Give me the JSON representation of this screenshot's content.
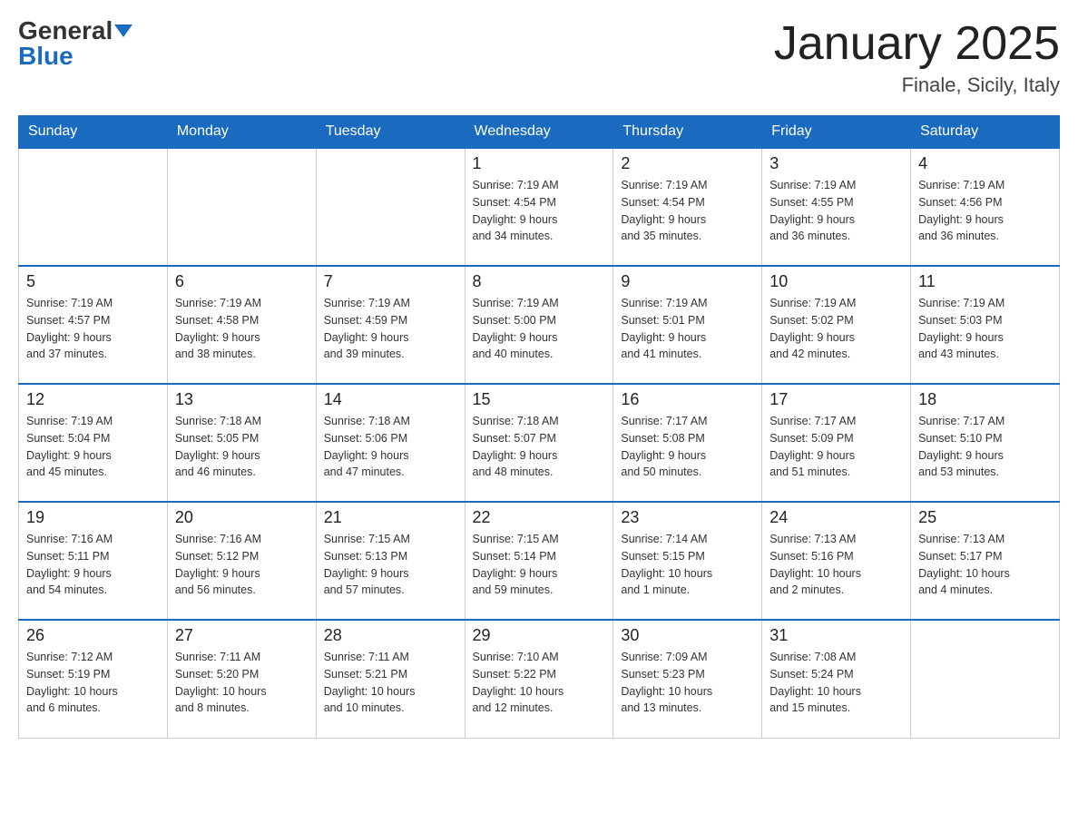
{
  "logo": {
    "general": "General",
    "blue": "Blue"
  },
  "header": {
    "month": "January 2025",
    "location": "Finale, Sicily, Italy"
  },
  "days_of_week": [
    "Sunday",
    "Monday",
    "Tuesday",
    "Wednesday",
    "Thursday",
    "Friday",
    "Saturday"
  ],
  "weeks": [
    [
      {
        "day": "",
        "info": ""
      },
      {
        "day": "",
        "info": ""
      },
      {
        "day": "",
        "info": ""
      },
      {
        "day": "1",
        "info": "Sunrise: 7:19 AM\nSunset: 4:54 PM\nDaylight: 9 hours\nand 34 minutes."
      },
      {
        "day": "2",
        "info": "Sunrise: 7:19 AM\nSunset: 4:54 PM\nDaylight: 9 hours\nand 35 minutes."
      },
      {
        "day": "3",
        "info": "Sunrise: 7:19 AM\nSunset: 4:55 PM\nDaylight: 9 hours\nand 36 minutes."
      },
      {
        "day": "4",
        "info": "Sunrise: 7:19 AM\nSunset: 4:56 PM\nDaylight: 9 hours\nand 36 minutes."
      }
    ],
    [
      {
        "day": "5",
        "info": "Sunrise: 7:19 AM\nSunset: 4:57 PM\nDaylight: 9 hours\nand 37 minutes."
      },
      {
        "day": "6",
        "info": "Sunrise: 7:19 AM\nSunset: 4:58 PM\nDaylight: 9 hours\nand 38 minutes."
      },
      {
        "day": "7",
        "info": "Sunrise: 7:19 AM\nSunset: 4:59 PM\nDaylight: 9 hours\nand 39 minutes."
      },
      {
        "day": "8",
        "info": "Sunrise: 7:19 AM\nSunset: 5:00 PM\nDaylight: 9 hours\nand 40 minutes."
      },
      {
        "day": "9",
        "info": "Sunrise: 7:19 AM\nSunset: 5:01 PM\nDaylight: 9 hours\nand 41 minutes."
      },
      {
        "day": "10",
        "info": "Sunrise: 7:19 AM\nSunset: 5:02 PM\nDaylight: 9 hours\nand 42 minutes."
      },
      {
        "day": "11",
        "info": "Sunrise: 7:19 AM\nSunset: 5:03 PM\nDaylight: 9 hours\nand 43 minutes."
      }
    ],
    [
      {
        "day": "12",
        "info": "Sunrise: 7:19 AM\nSunset: 5:04 PM\nDaylight: 9 hours\nand 45 minutes."
      },
      {
        "day": "13",
        "info": "Sunrise: 7:18 AM\nSunset: 5:05 PM\nDaylight: 9 hours\nand 46 minutes."
      },
      {
        "day": "14",
        "info": "Sunrise: 7:18 AM\nSunset: 5:06 PM\nDaylight: 9 hours\nand 47 minutes."
      },
      {
        "day": "15",
        "info": "Sunrise: 7:18 AM\nSunset: 5:07 PM\nDaylight: 9 hours\nand 48 minutes."
      },
      {
        "day": "16",
        "info": "Sunrise: 7:17 AM\nSunset: 5:08 PM\nDaylight: 9 hours\nand 50 minutes."
      },
      {
        "day": "17",
        "info": "Sunrise: 7:17 AM\nSunset: 5:09 PM\nDaylight: 9 hours\nand 51 minutes."
      },
      {
        "day": "18",
        "info": "Sunrise: 7:17 AM\nSunset: 5:10 PM\nDaylight: 9 hours\nand 53 minutes."
      }
    ],
    [
      {
        "day": "19",
        "info": "Sunrise: 7:16 AM\nSunset: 5:11 PM\nDaylight: 9 hours\nand 54 minutes."
      },
      {
        "day": "20",
        "info": "Sunrise: 7:16 AM\nSunset: 5:12 PM\nDaylight: 9 hours\nand 56 minutes."
      },
      {
        "day": "21",
        "info": "Sunrise: 7:15 AM\nSunset: 5:13 PM\nDaylight: 9 hours\nand 57 minutes."
      },
      {
        "day": "22",
        "info": "Sunrise: 7:15 AM\nSunset: 5:14 PM\nDaylight: 9 hours\nand 59 minutes."
      },
      {
        "day": "23",
        "info": "Sunrise: 7:14 AM\nSunset: 5:15 PM\nDaylight: 10 hours\nand 1 minute."
      },
      {
        "day": "24",
        "info": "Sunrise: 7:13 AM\nSunset: 5:16 PM\nDaylight: 10 hours\nand 2 minutes."
      },
      {
        "day": "25",
        "info": "Sunrise: 7:13 AM\nSunset: 5:17 PM\nDaylight: 10 hours\nand 4 minutes."
      }
    ],
    [
      {
        "day": "26",
        "info": "Sunrise: 7:12 AM\nSunset: 5:19 PM\nDaylight: 10 hours\nand 6 minutes."
      },
      {
        "day": "27",
        "info": "Sunrise: 7:11 AM\nSunset: 5:20 PM\nDaylight: 10 hours\nand 8 minutes."
      },
      {
        "day": "28",
        "info": "Sunrise: 7:11 AM\nSunset: 5:21 PM\nDaylight: 10 hours\nand 10 minutes."
      },
      {
        "day": "29",
        "info": "Sunrise: 7:10 AM\nSunset: 5:22 PM\nDaylight: 10 hours\nand 12 minutes."
      },
      {
        "day": "30",
        "info": "Sunrise: 7:09 AM\nSunset: 5:23 PM\nDaylight: 10 hours\nand 13 minutes."
      },
      {
        "day": "31",
        "info": "Sunrise: 7:08 AM\nSunset: 5:24 PM\nDaylight: 10 hours\nand 15 minutes."
      },
      {
        "day": "",
        "info": ""
      }
    ]
  ]
}
